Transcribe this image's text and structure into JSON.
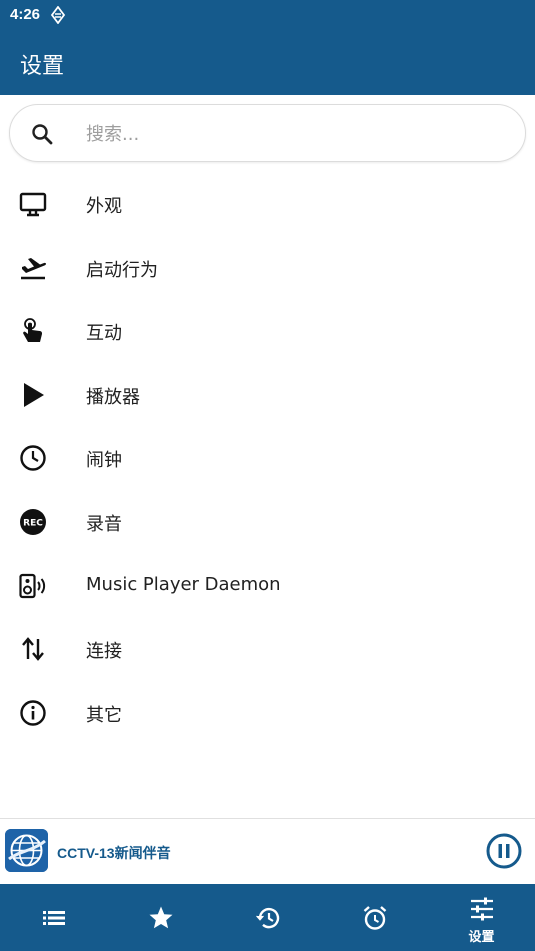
{
  "status_bar": {
    "time": "4:26"
  },
  "app_bar": {
    "title": "设置"
  },
  "search": {
    "placeholder": "搜索..."
  },
  "menu": {
    "items": [
      {
        "label": "外观",
        "icon": "monitor-icon"
      },
      {
        "label": "启动行为",
        "icon": "airplane-takeoff-icon"
      },
      {
        "label": "互动",
        "icon": "touch-hand-icon"
      },
      {
        "label": "播放器",
        "icon": "play-icon"
      },
      {
        "label": "闹钟",
        "icon": "clock-icon"
      },
      {
        "label": "录音",
        "icon": "rec-icon"
      },
      {
        "label": "Music Player Daemon",
        "icon": "speaker-icon"
      },
      {
        "label": "连接",
        "icon": "swap-vertical-icon"
      },
      {
        "label": "其它",
        "icon": "info-icon"
      }
    ]
  },
  "player": {
    "station_name": "CCTV-13新闻伴音",
    "state": "playing"
  },
  "bottom_nav": {
    "items": [
      {
        "icon": "list-icon"
      },
      {
        "icon": "star-icon"
      },
      {
        "icon": "history-icon"
      },
      {
        "icon": "alarm-icon"
      },
      {
        "icon": "settings-sliders-icon",
        "label": "设置",
        "active": true
      }
    ]
  },
  "colors": {
    "primary": "#155a8c",
    "text": "#212121",
    "placeholder": "#9e9e9e"
  }
}
